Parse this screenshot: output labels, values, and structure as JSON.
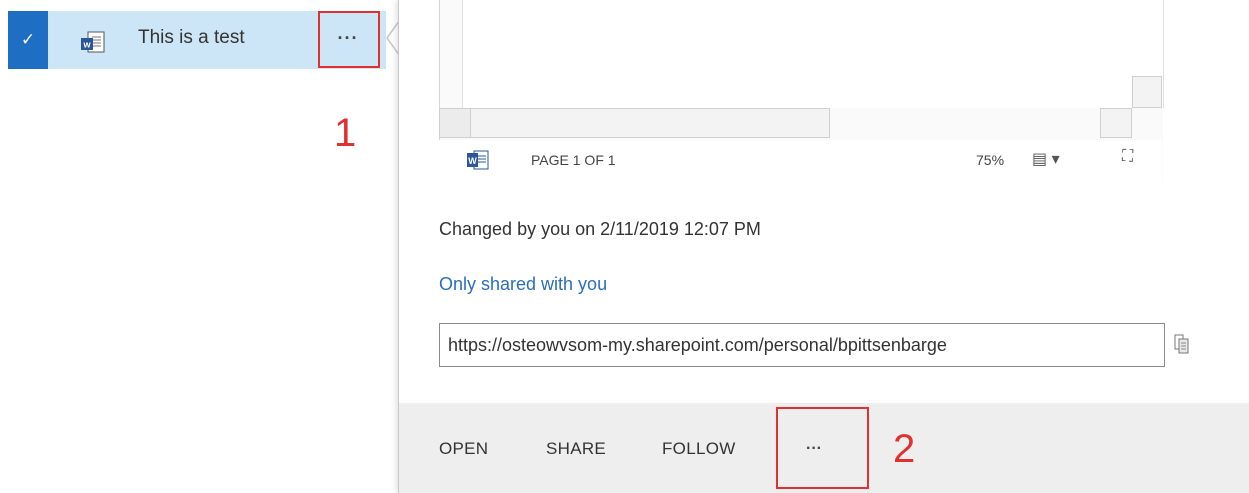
{
  "file_row": {
    "check": "✓",
    "file_name": "This is a test",
    "more_label": "···"
  },
  "annotations": {
    "first": "1",
    "second": "2"
  },
  "callout": {
    "status_bar": {
      "page_label": "PAGE 1 OF 1",
      "zoom": "75%",
      "view_label": "▤ ▾",
      "fit_label": "⛶"
    },
    "changed_text": "Changed by you on 2/11/2019 12:07 PM",
    "sharing_link": "Only shared with you",
    "url_value": "https://osteowvsom-my.sharepoint.com/personal/bpittsenbarge",
    "actions": {
      "open": "OPEN",
      "share": "SHARE",
      "follow": "FOLLOW",
      "more": "···"
    }
  },
  "colors": {
    "row_selected": "#cde6f7",
    "check_bg": "#1e6fc4",
    "annotation_red": "#e03030",
    "link_blue": "#2a6ebb",
    "action_bar_bg": "#eeeeee",
    "word_blue": "#2b579a"
  },
  "icons": {
    "row_check": "checkmark-icon",
    "row_doc": "word-document-icon",
    "status_word": "word-icon",
    "copy": "copy-to-clipboard-icon",
    "view": "view-mode-icon",
    "fit": "fit-to-window-icon"
  }
}
